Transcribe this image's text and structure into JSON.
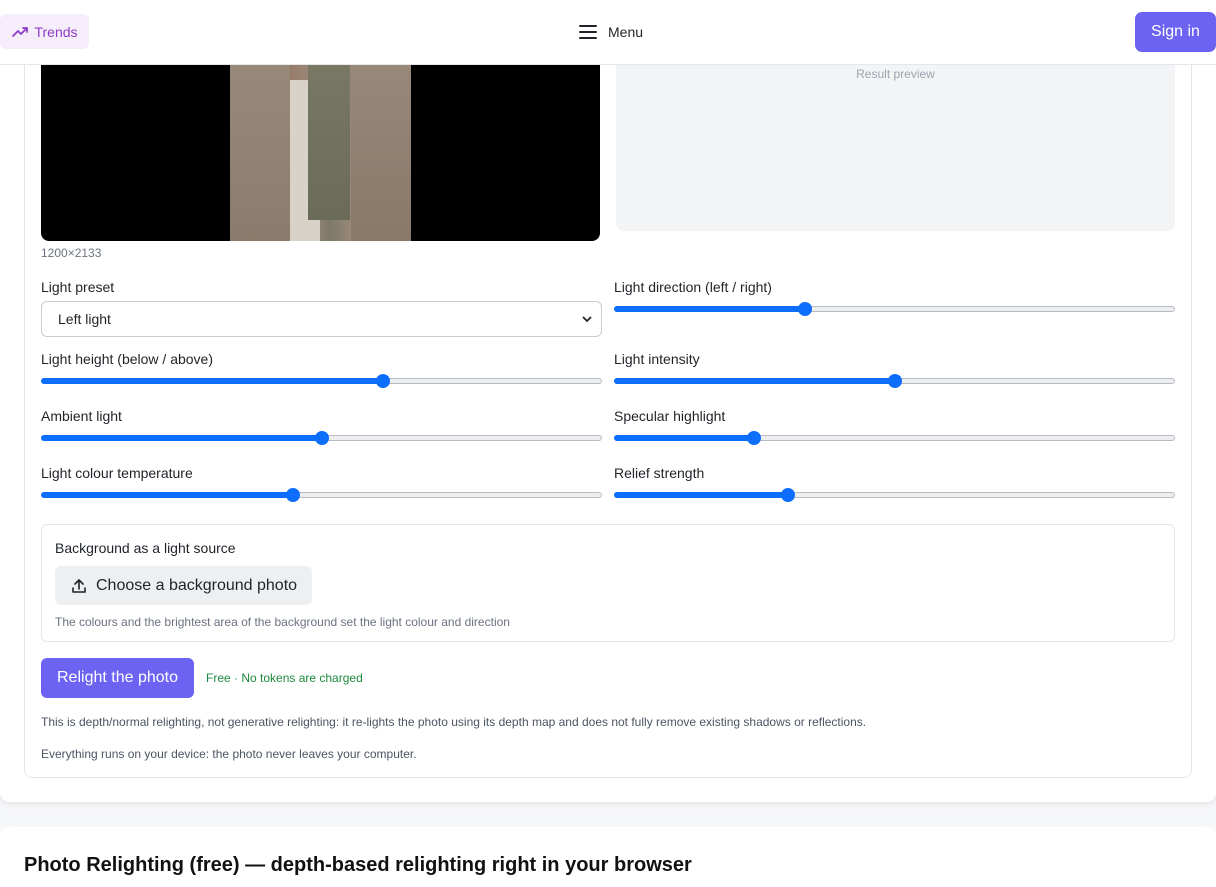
{
  "header": {
    "trends_label": "Trends",
    "menu_label": "Menu",
    "signin_label": "Sign in"
  },
  "original": {
    "dimensions": "1200×2133"
  },
  "preview": {
    "label": "Result preview"
  },
  "controls": {
    "preset_label": "Light preset",
    "preset_value": "Left light",
    "direction_label": "Light direction (left / right)",
    "direction_value": 0.34,
    "height_label": "Light height (below / above)",
    "height_value": 0.61,
    "intensity_label": "Light intensity",
    "intensity_value": 0.5,
    "ambient_label": "Ambient light",
    "ambient_value": 0.5,
    "specular_label": "Specular highlight",
    "specular_value": 0.25,
    "temperature_label": "Light colour temperature",
    "temperature_value": 0.45,
    "relief_label": "Relief strength",
    "relief_value": 0.31
  },
  "background_source": {
    "title": "Background as a light source",
    "button_label": "Choose a background photo",
    "hint": "The colours and the brightest area of the background set the light colour and direction"
  },
  "action": {
    "relight_label": "Relight the photo",
    "free_note": "Free · No tokens are charged"
  },
  "notes": {
    "depth_note": "This is depth/normal relighting, not generative relighting: it re-lights the photo using its depth map and does not fully remove existing shadows or reflections.",
    "privacy_note": "Everything runs on your device: the photo never leaves your computer."
  },
  "section": {
    "title": "Photo Relighting (free) — depth-based relighting right in your browser"
  },
  "colors": {
    "accent": "#6c63f2",
    "slider": "#0d6efd",
    "trends": "#8e3cc8",
    "free_green": "#1c8a3c"
  }
}
